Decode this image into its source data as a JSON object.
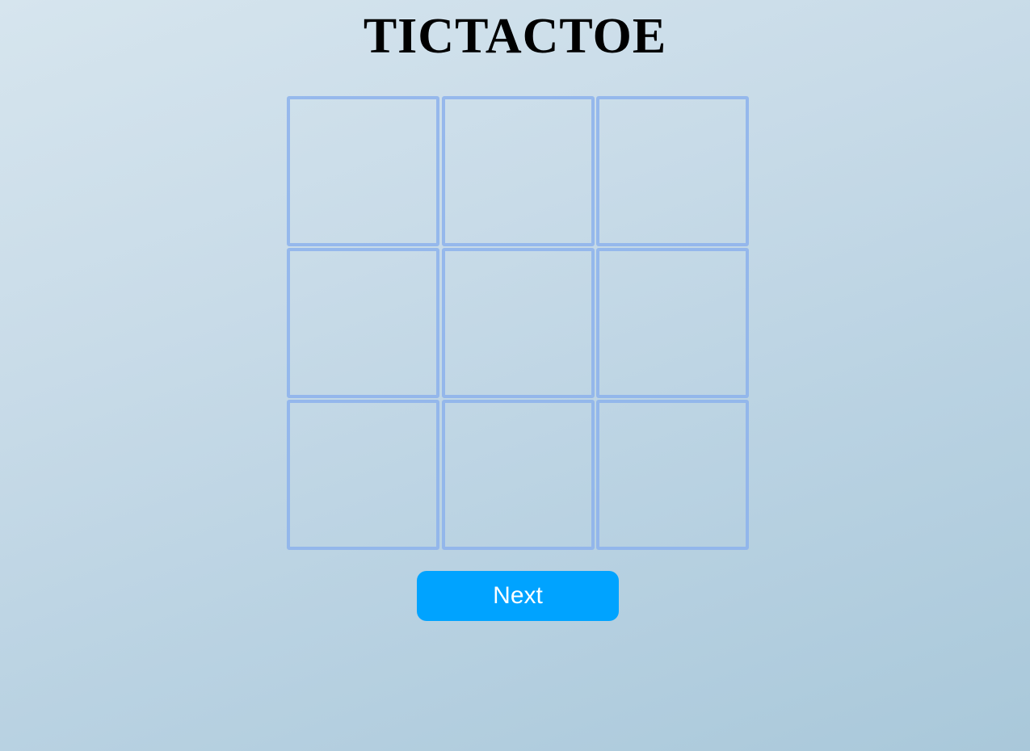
{
  "title": "TICTACTOE",
  "board": {
    "cells": [
      "",
      "",
      "",
      "",
      "",
      "",
      "",
      "",
      ""
    ]
  },
  "controls": {
    "next_label": "Next"
  },
  "colors": {
    "cell_border": "#8cb2ec",
    "button_background": "#00a3ff",
    "button_text": "#ffffff",
    "title_text": "#000000"
  }
}
